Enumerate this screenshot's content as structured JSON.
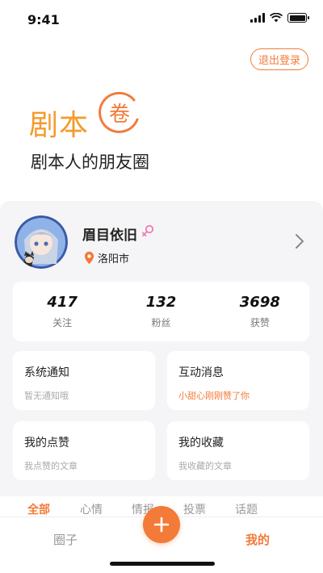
{
  "status_bar": {
    "time": "9:41"
  },
  "header": {
    "logout_label": "退出登录",
    "logo_text": "剧本",
    "logo_seal_char": "卷",
    "slogan": "剧本人的朋友圈"
  },
  "profile": {
    "username": "眉目依旧",
    "gender_icon": "female-icon",
    "location": "洛阳市"
  },
  "stats": [
    {
      "value": "417",
      "label": "关注"
    },
    {
      "value": "132",
      "label": "粉丝"
    },
    {
      "value": "3698",
      "label": "获赞"
    }
  ],
  "cards": {
    "system_notice": {
      "title": "系统通知",
      "subtitle": "暂无通知哦"
    },
    "interaction": {
      "title": "互动消息",
      "subtitle": "小甜心刚刚赞了你"
    },
    "my_likes": {
      "title": "我的点赞",
      "subtitle": "我点赞的文章"
    },
    "my_favorites": {
      "title": "我的收藏",
      "subtitle": "我收藏的文章"
    }
  },
  "tabs": [
    "全部",
    "心情",
    "情报",
    "投票",
    "话题"
  ],
  "bottom_nav": {
    "left": "圈子",
    "right": "我的"
  },
  "colors": {
    "accent": "#f37a38",
    "logo": "#f39c2c",
    "panel_bg": "#f5f5f7"
  }
}
